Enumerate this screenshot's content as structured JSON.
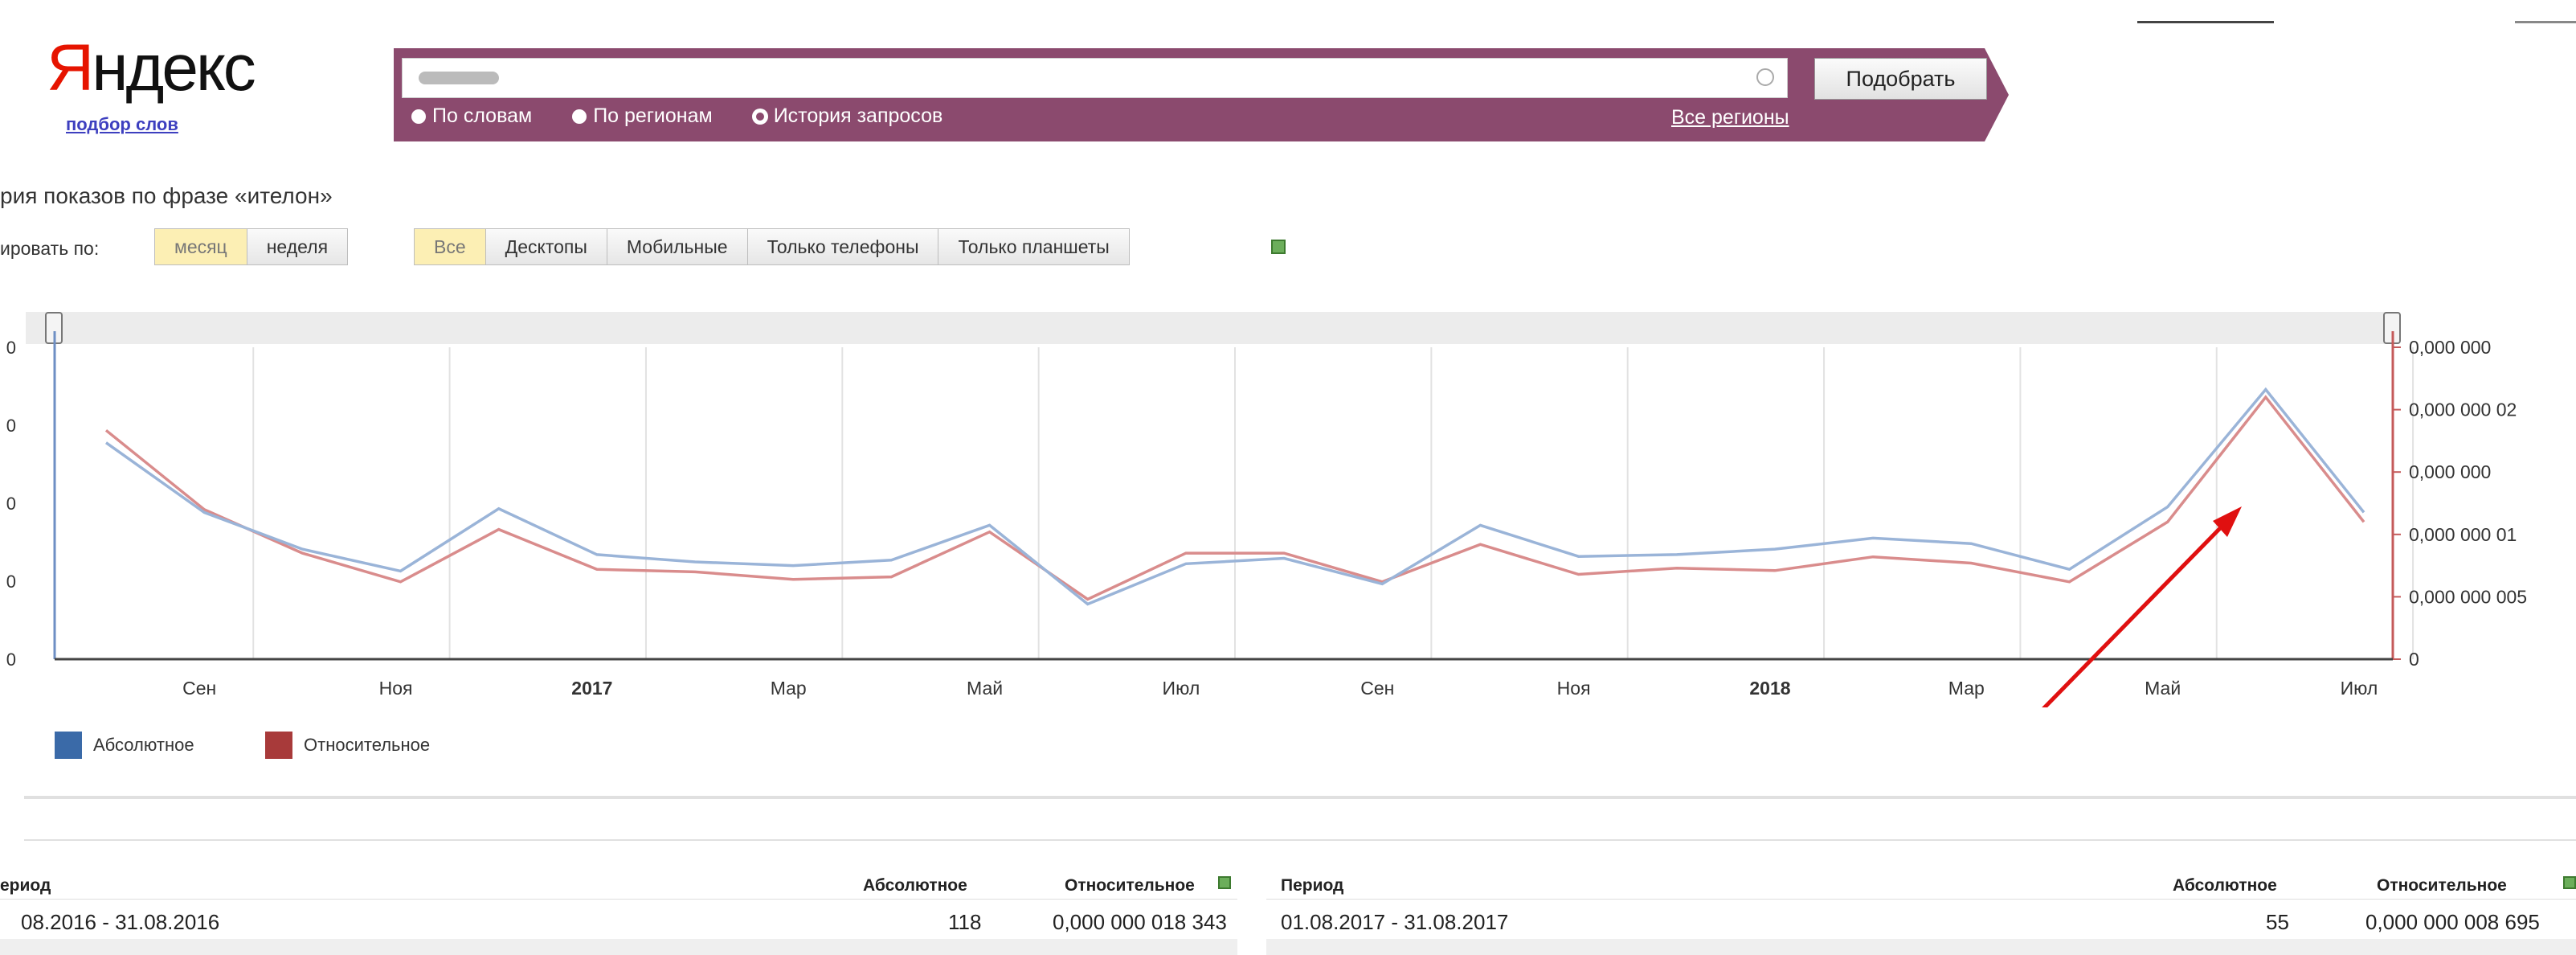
{
  "logo": {
    "first_letter": "Я",
    "rest": "ндекс",
    "subtitle": "подбор слов"
  },
  "search": {
    "button_label": "Подобрать",
    "modes": [
      {
        "label": "По словам",
        "selected": false
      },
      {
        "label": "По регионам",
        "selected": false
      },
      {
        "label": "История запросов",
        "selected": true
      }
    ],
    "regions_link": "Все регионы"
  },
  "heading": "рия показов по фразе «ителон»",
  "grouping": {
    "label": "ировать по:",
    "options": [
      {
        "label": "месяц",
        "active": true
      },
      {
        "label": "неделя",
        "active": false
      }
    ]
  },
  "devices": [
    {
      "label": "Все",
      "active": true
    },
    {
      "label": "Десктопы",
      "active": false
    },
    {
      "label": "Мобильные",
      "active": false
    },
    {
      "label": "Только телефоны",
      "active": false
    },
    {
      "label": "Только планшеты",
      "active": false
    }
  ],
  "colors": {
    "band": "#8b4a6e",
    "absolute": "#9ab4d8",
    "relative": "#d98c8c",
    "arrow": "#e01010",
    "legend_abs": "#3a6aa8",
    "legend_rel": "#a83a3a"
  },
  "chart_data": {
    "type": "line",
    "x_labels": [
      "Сен",
      "Ноя",
      "2017",
      "Мар",
      "Май",
      "Июл",
      "Сен",
      "Ноя",
      "2018",
      "Мар",
      "Май",
      "Июл"
    ],
    "x_labels_bold": [
      "2017",
      "2018"
    ],
    "right_axis_ticks": [
      "0,000 000",
      "0,000 000 02",
      "0,000 000",
      "0,000 000 01",
      "0,000 000 005",
      "0"
    ],
    "left_axis_ticks": [
      "0",
      "0",
      "0",
      "0",
      "0"
    ],
    "series": [
      {
        "name": "Абсолютное",
        "values": [
          118,
          80,
          60,
          48,
          82,
          57,
          53,
          51,
          54,
          73,
          30,
          52,
          55,
          41,
          73,
          56,
          57,
          60,
          66,
          63,
          49,
          83,
          147,
          80
        ]
      },
      {
        "name": "Относительное",
        "values": [
          1.8343e-08,
          1.2e-08,
          8.5e-09,
          6.2e-09,
          1.04e-08,
          7.2e-09,
          7e-09,
          6.4e-09,
          6.6e-09,
          1.02e-08,
          4.8e-09,
          8.5e-09,
          8.5e-09,
          6.2e-09,
          9.2e-09,
          6.8e-09,
          7.3e-09,
          7.1e-09,
          8.2e-09,
          7.7e-09,
          6.2e-09,
          1.1e-08,
          2.1e-08,
          1.1e-08
        ]
      }
    ]
  },
  "table_left": {
    "headers": [
      "ериод",
      "Абсолютное",
      "Относительное"
    ],
    "rows": [
      [
        "08.2016 - 31.08.2016",
        "118",
        "0,000 000 018 343"
      ]
    ]
  },
  "table_right": {
    "headers": [
      "Период",
      "Абсолютное",
      "Относительное"
    ],
    "rows": [
      [
        "01.08.2017 - 31.08.2017",
        "55",
        "0,000 000 008 695"
      ]
    ]
  }
}
